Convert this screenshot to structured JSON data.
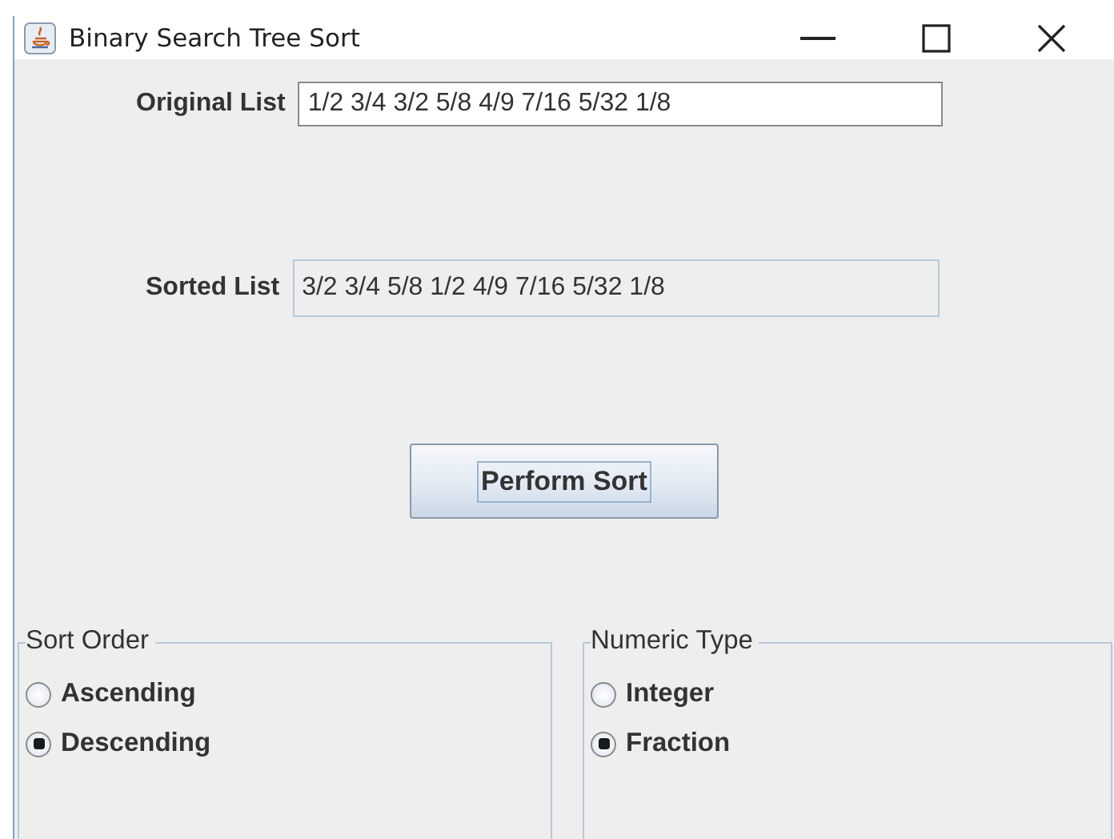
{
  "window": {
    "title": "Binary Search Tree Sort"
  },
  "original_list": {
    "label": "Original List",
    "value": "1/2 3/4 3/2 5/8 4/9 7/16 5/32 1/8"
  },
  "sorted_list": {
    "label": "Sorted List",
    "value": "3/2 3/4 5/8 1/2 4/9 7/16 5/32 1/8"
  },
  "sort_button": {
    "label": "Perform Sort"
  },
  "groups": [
    {
      "title": "Sort Order",
      "options": [
        {
          "label": "Ascending",
          "selected": false
        },
        {
          "label": "Descending",
          "selected": true
        }
      ]
    },
    {
      "title": "Numeric Type",
      "options": [
        {
          "label": "Integer",
          "selected": false
        },
        {
          "label": "Fraction",
          "selected": true
        }
      ]
    }
  ]
}
